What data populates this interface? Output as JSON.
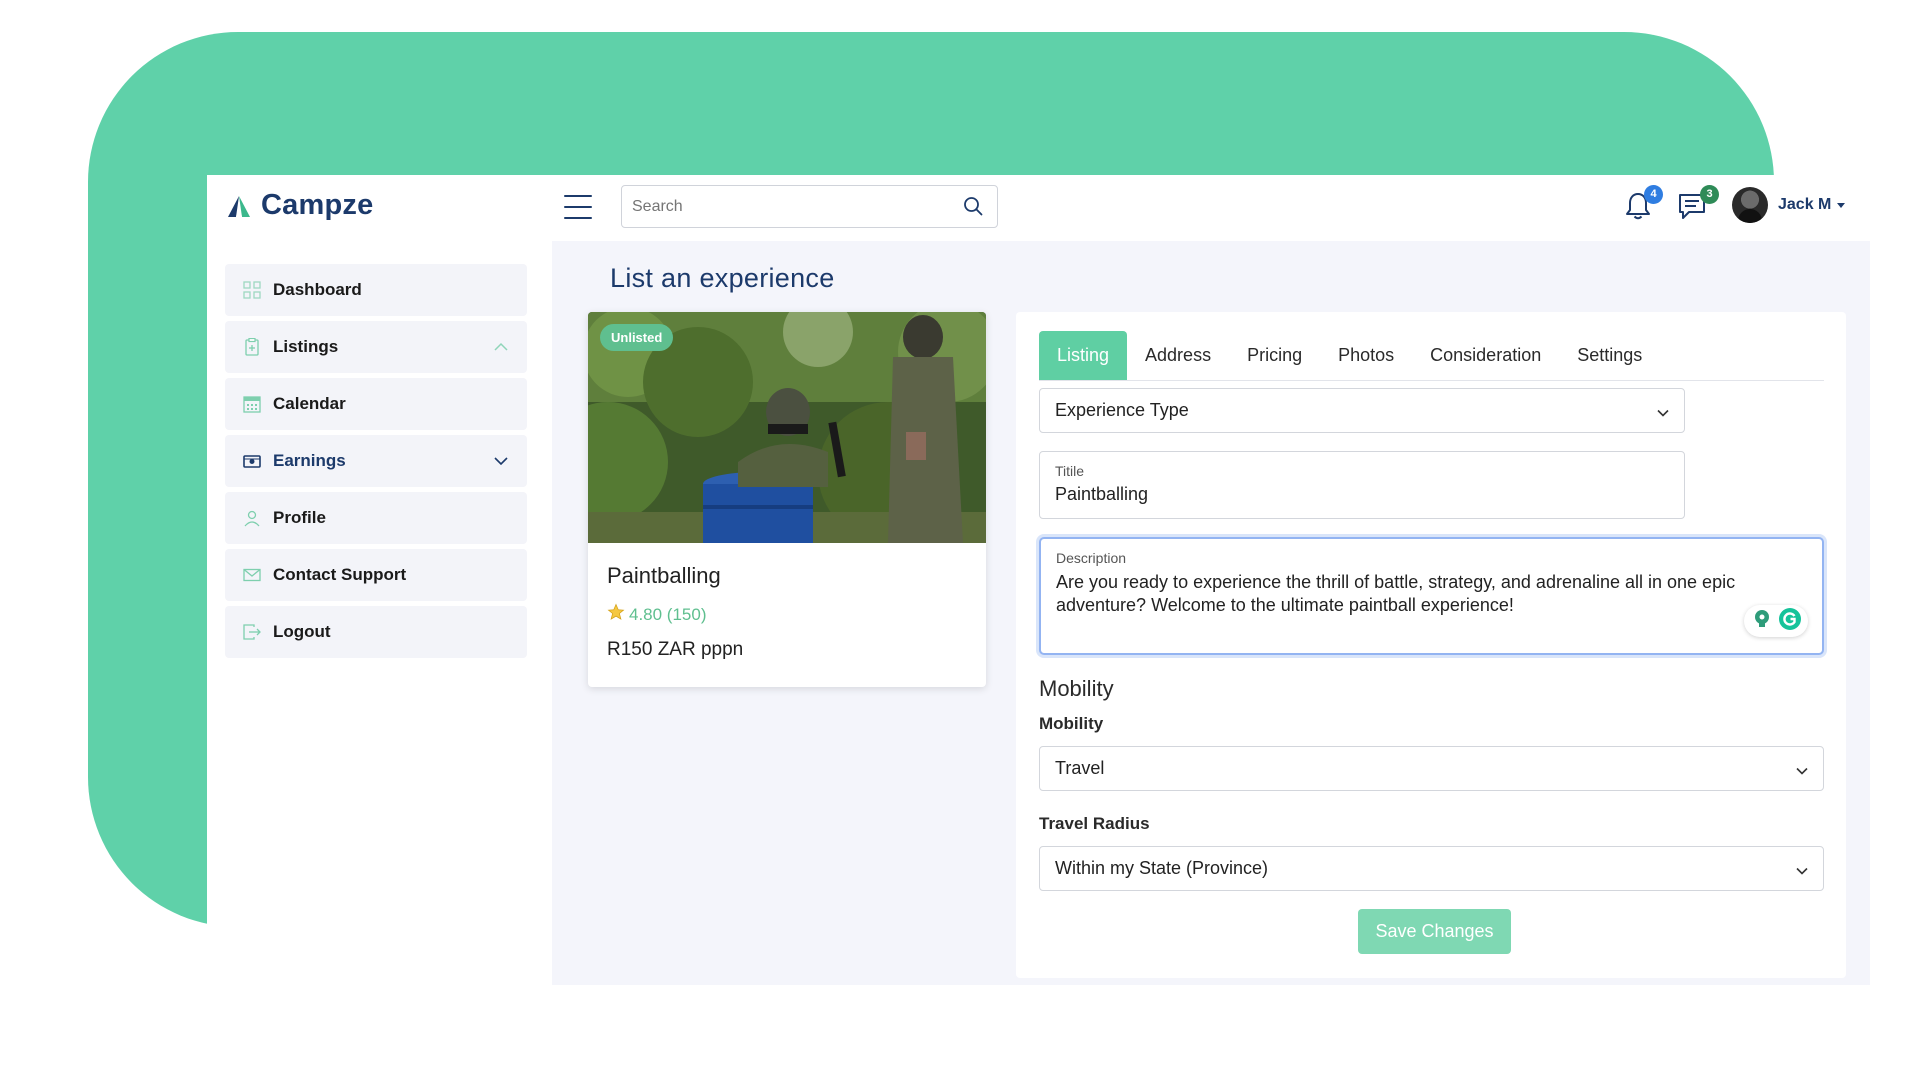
{
  "app": {
    "name": "Campze"
  },
  "header": {
    "search_placeholder": "Search",
    "notifications_count": "4",
    "messages_count": "3",
    "user_name": "Jack M"
  },
  "sidebar": {
    "items": [
      {
        "label": "Dashboard",
        "icon": "dashboard-icon"
      },
      {
        "label": "Listings",
        "icon": "listings-icon",
        "expanded": true
      },
      {
        "label": "Calendar",
        "icon": "calendar-icon"
      },
      {
        "label": "Earnings",
        "icon": "earnings-icon",
        "expanded": false
      },
      {
        "label": "Profile",
        "icon": "profile-icon"
      },
      {
        "label": "Contact Support",
        "icon": "mail-icon"
      },
      {
        "label": "Logout",
        "icon": "logout-icon"
      }
    ]
  },
  "page": {
    "title": "List an experience"
  },
  "card": {
    "badge": "Unlisted",
    "title": "Paintballing",
    "rating": "4.80 (150)",
    "price": "R150 ZAR pppn"
  },
  "form": {
    "tabs": [
      "Listing",
      "Address",
      "Pricing",
      "Photos",
      "Consideration",
      "Settings"
    ],
    "active_tab": "Listing",
    "experience_type": "Experience Type",
    "title_label": "Titile",
    "title_value": "Paintballing",
    "description_label": "Description",
    "description_value": "Are you ready to experience the thrill of battle, strategy, and adrenaline all in one epic adventure? Welcome to the ultimate paintball experience!",
    "mobility_section": "Mobility",
    "mobility_label": "Mobility",
    "mobility_value": "Travel",
    "travel_radius_label": "Travel Radius",
    "travel_radius_value": "Within my State (Province)",
    "save_label": "Save Changes"
  },
  "colors": {
    "brand_green": "#5fd1a9",
    "active_tab": "#5fcfa3",
    "navy": "#1c3a6b",
    "save_button": "#7fd8b3",
    "badge_blue": "#2f7de1",
    "badge_green": "#2e8b57"
  }
}
